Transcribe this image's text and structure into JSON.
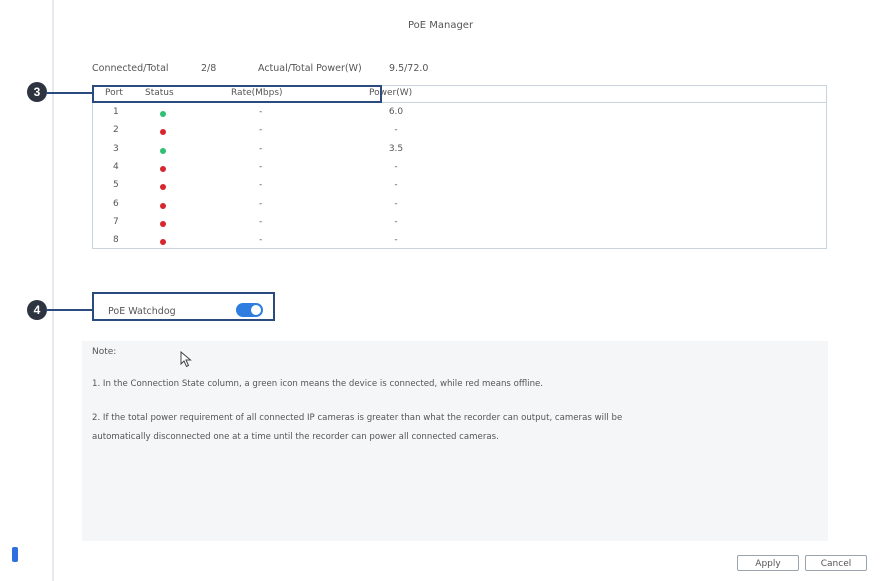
{
  "page_title": "PoE Manager",
  "summary": {
    "connected_label": "Connected/Total",
    "connected_value": "2/8",
    "power_label": "Actual/Total Power(W)",
    "power_value": "9.5/72.0"
  },
  "table": {
    "headers": {
      "port": "Port",
      "status": "Status",
      "rate": "Rate(Mbps)",
      "power": "Power(W)"
    },
    "rows": [
      {
        "port": "1",
        "status": "connected",
        "rate": "-",
        "power": "6.0"
      },
      {
        "port": "2",
        "status": "offline",
        "rate": "-",
        "power": "-"
      },
      {
        "port": "3",
        "status": "connected",
        "rate": "-",
        "power": "3.5"
      },
      {
        "port": "4",
        "status": "offline",
        "rate": "-",
        "power": "-"
      },
      {
        "port": "5",
        "status": "offline",
        "rate": "-",
        "power": "-"
      },
      {
        "port": "6",
        "status": "offline",
        "rate": "-",
        "power": "-"
      },
      {
        "port": "7",
        "status": "offline",
        "rate": "-",
        "power": "-"
      },
      {
        "port": "8",
        "status": "offline",
        "rate": "-",
        "power": "-"
      }
    ]
  },
  "watchdog": {
    "label": "PoE Watchdog",
    "enabled": true
  },
  "callouts": {
    "table": "3",
    "watchdog": "4"
  },
  "notes": {
    "title": "Note:",
    "line1": "1. In the Connection State column, a green icon means the device is connected, while red means offline.",
    "line2a": "2. If the total power requirement of all connected IP cameras is greater than what the recorder can output, cameras will be",
    "line2b": "automatically disconnected one at a time until the recorder can power all connected cameras."
  },
  "buttons": {
    "apply": "Apply",
    "cancel": "Cancel"
  },
  "colors": {
    "connected": "#2fbf71",
    "offline": "#d7262e",
    "accent": "#2f7de1",
    "callout": "#2b4a7f"
  }
}
